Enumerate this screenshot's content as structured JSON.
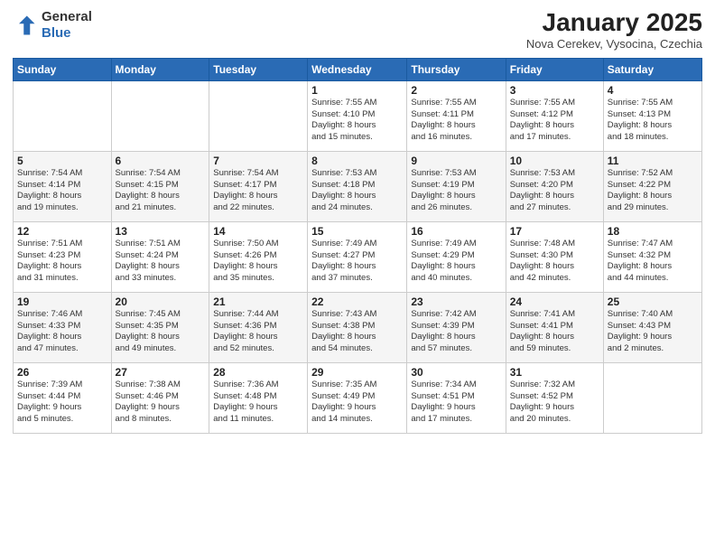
{
  "header": {
    "logo_general": "General",
    "logo_blue": "Blue",
    "month_title": "January 2025",
    "subtitle": "Nova Cerekev, Vysocina, Czechia"
  },
  "weekdays": [
    "Sunday",
    "Monday",
    "Tuesday",
    "Wednesday",
    "Thursday",
    "Friday",
    "Saturday"
  ],
  "weeks": [
    [
      {
        "day": "",
        "info": ""
      },
      {
        "day": "",
        "info": ""
      },
      {
        "day": "",
        "info": ""
      },
      {
        "day": "1",
        "info": "Sunrise: 7:55 AM\nSunset: 4:10 PM\nDaylight: 8 hours\nand 15 minutes."
      },
      {
        "day": "2",
        "info": "Sunrise: 7:55 AM\nSunset: 4:11 PM\nDaylight: 8 hours\nand 16 minutes."
      },
      {
        "day": "3",
        "info": "Sunrise: 7:55 AM\nSunset: 4:12 PM\nDaylight: 8 hours\nand 17 minutes."
      },
      {
        "day": "4",
        "info": "Sunrise: 7:55 AM\nSunset: 4:13 PM\nDaylight: 8 hours\nand 18 minutes."
      }
    ],
    [
      {
        "day": "5",
        "info": "Sunrise: 7:54 AM\nSunset: 4:14 PM\nDaylight: 8 hours\nand 19 minutes."
      },
      {
        "day": "6",
        "info": "Sunrise: 7:54 AM\nSunset: 4:15 PM\nDaylight: 8 hours\nand 21 minutes."
      },
      {
        "day": "7",
        "info": "Sunrise: 7:54 AM\nSunset: 4:17 PM\nDaylight: 8 hours\nand 22 minutes."
      },
      {
        "day": "8",
        "info": "Sunrise: 7:53 AM\nSunset: 4:18 PM\nDaylight: 8 hours\nand 24 minutes."
      },
      {
        "day": "9",
        "info": "Sunrise: 7:53 AM\nSunset: 4:19 PM\nDaylight: 8 hours\nand 26 minutes."
      },
      {
        "day": "10",
        "info": "Sunrise: 7:53 AM\nSunset: 4:20 PM\nDaylight: 8 hours\nand 27 minutes."
      },
      {
        "day": "11",
        "info": "Sunrise: 7:52 AM\nSunset: 4:22 PM\nDaylight: 8 hours\nand 29 minutes."
      }
    ],
    [
      {
        "day": "12",
        "info": "Sunrise: 7:51 AM\nSunset: 4:23 PM\nDaylight: 8 hours\nand 31 minutes."
      },
      {
        "day": "13",
        "info": "Sunrise: 7:51 AM\nSunset: 4:24 PM\nDaylight: 8 hours\nand 33 minutes."
      },
      {
        "day": "14",
        "info": "Sunrise: 7:50 AM\nSunset: 4:26 PM\nDaylight: 8 hours\nand 35 minutes."
      },
      {
        "day": "15",
        "info": "Sunrise: 7:49 AM\nSunset: 4:27 PM\nDaylight: 8 hours\nand 37 minutes."
      },
      {
        "day": "16",
        "info": "Sunrise: 7:49 AM\nSunset: 4:29 PM\nDaylight: 8 hours\nand 40 minutes."
      },
      {
        "day": "17",
        "info": "Sunrise: 7:48 AM\nSunset: 4:30 PM\nDaylight: 8 hours\nand 42 minutes."
      },
      {
        "day": "18",
        "info": "Sunrise: 7:47 AM\nSunset: 4:32 PM\nDaylight: 8 hours\nand 44 minutes."
      }
    ],
    [
      {
        "day": "19",
        "info": "Sunrise: 7:46 AM\nSunset: 4:33 PM\nDaylight: 8 hours\nand 47 minutes."
      },
      {
        "day": "20",
        "info": "Sunrise: 7:45 AM\nSunset: 4:35 PM\nDaylight: 8 hours\nand 49 minutes."
      },
      {
        "day": "21",
        "info": "Sunrise: 7:44 AM\nSunset: 4:36 PM\nDaylight: 8 hours\nand 52 minutes."
      },
      {
        "day": "22",
        "info": "Sunrise: 7:43 AM\nSunset: 4:38 PM\nDaylight: 8 hours\nand 54 minutes."
      },
      {
        "day": "23",
        "info": "Sunrise: 7:42 AM\nSunset: 4:39 PM\nDaylight: 8 hours\nand 57 minutes."
      },
      {
        "day": "24",
        "info": "Sunrise: 7:41 AM\nSunset: 4:41 PM\nDaylight: 8 hours\nand 59 minutes."
      },
      {
        "day": "25",
        "info": "Sunrise: 7:40 AM\nSunset: 4:43 PM\nDaylight: 9 hours\nand 2 minutes."
      }
    ],
    [
      {
        "day": "26",
        "info": "Sunrise: 7:39 AM\nSunset: 4:44 PM\nDaylight: 9 hours\nand 5 minutes."
      },
      {
        "day": "27",
        "info": "Sunrise: 7:38 AM\nSunset: 4:46 PM\nDaylight: 9 hours\nand 8 minutes."
      },
      {
        "day": "28",
        "info": "Sunrise: 7:36 AM\nSunset: 4:48 PM\nDaylight: 9 hours\nand 11 minutes."
      },
      {
        "day": "29",
        "info": "Sunrise: 7:35 AM\nSunset: 4:49 PM\nDaylight: 9 hours\nand 14 minutes."
      },
      {
        "day": "30",
        "info": "Sunrise: 7:34 AM\nSunset: 4:51 PM\nDaylight: 9 hours\nand 17 minutes."
      },
      {
        "day": "31",
        "info": "Sunrise: 7:32 AM\nSunset: 4:52 PM\nDaylight: 9 hours\nand 20 minutes."
      },
      {
        "day": "",
        "info": ""
      }
    ]
  ]
}
